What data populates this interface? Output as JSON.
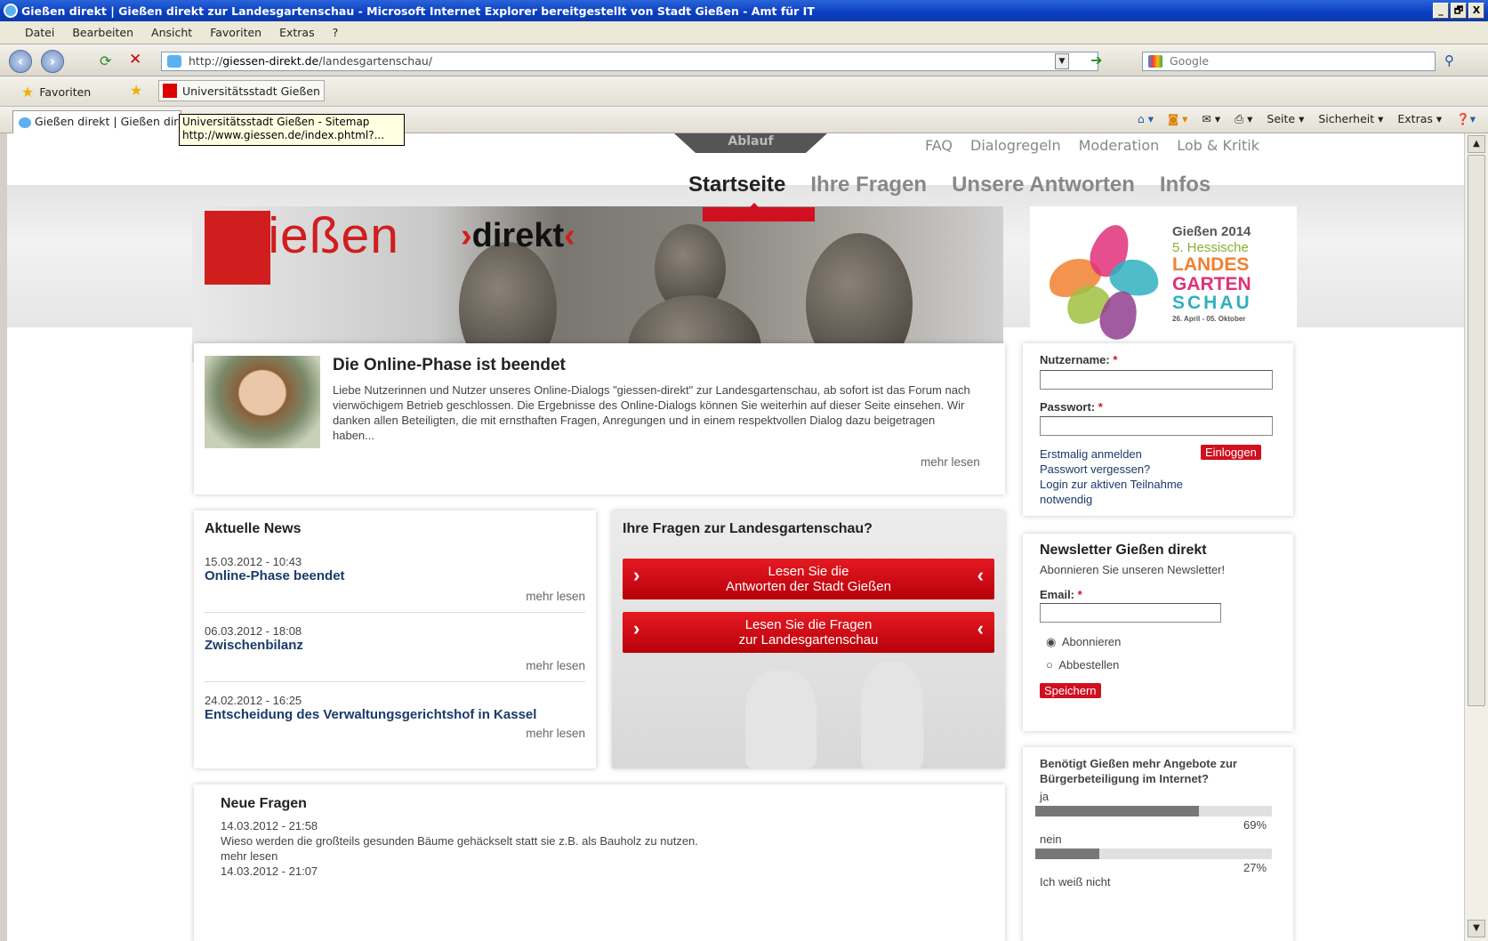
{
  "window": {
    "title": "Gießen direkt | Gießen direkt zur Landesgartenschau - Microsoft Internet Explorer bereitgestellt von Stadt Gießen - Amt für IT",
    "buttons": [
      "_",
      "🗗",
      "X"
    ]
  },
  "menu": [
    "Datei",
    "Bearbeiten",
    "Ansicht",
    "Favoriten",
    "Extras",
    "?"
  ],
  "address": {
    "prefix": "http://",
    "host": "giessen-direkt.de",
    "path": "/landesgartenschau/"
  },
  "search": {
    "placeholder": "Google"
  },
  "favorites": {
    "label": "Favoriten",
    "item": "Universitätsstadt Gießen"
  },
  "tab": {
    "label": "Gießen direkt | Gießen direkt zur Landesgartenschau"
  },
  "tooltip": {
    "line1": "Universitätsstadt Gießen - Sitemap",
    "line2": "http://www.giessen.de/index.phtml?..."
  },
  "commandbar": [
    "Seite ▾",
    "Sicherheit ▾",
    "Extras ▾"
  ],
  "site": {
    "ablauf": "Ablauf",
    "toplinks": [
      "FAQ",
      "Dialogregeln",
      "Moderation",
      "Lob & Kritik"
    ],
    "nav": [
      "Startseite",
      "Ihre Fragen",
      "Unsere Antworten",
      "Infos"
    ],
    "logo": {
      "main": "Gießen",
      "direkt_open": "›",
      "direkt": "direkt",
      "direkt_close": "‹"
    },
    "lgs": {
      "l1": "Gießen 2014",
      "l2": "5. Hessische",
      "l3": "LANDES",
      "l4": "GARTEN",
      "l5": "SCHAU",
      "l6": "26. April - 05. Oktober"
    },
    "online": {
      "title": "Die Online-Phase ist beendet",
      "text": "Liebe Nutzerinnen und Nutzer unseres Online-Dialogs \"giessen-direkt\" zur Landesgartenschau, ab sofort ist das Forum nach vierwöchigem Betrieb geschlossen. Die Ergebnisse des Online-Dialogs können Sie weiterhin auf dieser Seite einsehen. Wir danken allen Beteiligten, die mit ernsthaften Fragen, Anregungen und in einem respektvollen Dialog dazu beigetragen haben...",
      "more": "mehr lesen"
    },
    "news": {
      "title": "Aktuelle News",
      "items": [
        {
          "date": "15.03.2012 - 10:43",
          "title": "Online-Phase beendet",
          "more": "mehr lesen"
        },
        {
          "date": "06.03.2012 - 18:08",
          "title": "Zwischenbilanz",
          "more": "mehr lesen"
        },
        {
          "date": "24.02.2012 - 16:25",
          "title": "Entscheidung des Verwaltungsgerichtshof in Kassel",
          "more": "mehr lesen"
        }
      ]
    },
    "fragen": {
      "title": "Ihre Fragen zur Landesgartenschau?",
      "btn1_l1": "Lesen Sie die",
      "btn1_l2": "Antworten der Stadt Gießen",
      "btn2_l1": "Lesen Sie die Fragen",
      "btn2_l2": "zur Landesgartenschau"
    },
    "neue": {
      "title": "Neue Fragen",
      "d1": "14.03.2012 - 21:58",
      "q1": "Wieso werden die großteils gesunden Bäume gehäckselt statt sie z.B. als Bauholz zu nutzen.",
      "more": "mehr lesen",
      "d2": "14.03.2012 - 21:07"
    },
    "login": {
      "user": "Nutzername:",
      "pass": "Passwort:",
      "req": "*",
      "register": "Erstmalig anmelden",
      "login": "Einloggen",
      "forgot": "Passwort vergessen?",
      "hint1": "Login zur aktiven Teilnahme",
      "hint2": "notwendig"
    },
    "newsletter": {
      "title": "Newsletter Gießen direkt",
      "sub": "Abonnieren Sie unseren Newsletter!",
      "email": "Email:",
      "opt1": "Abonnieren",
      "opt2": "Abbestellen",
      "save": "Speichern"
    },
    "poll": {
      "question": "Benötigt Gießen mehr Angebote zur Bürgerbeteiligung im Internet?",
      "options": [
        {
          "label": "ja",
          "pct": "69%",
          "value": 69
        },
        {
          "label": "nein",
          "pct": "27%",
          "value": 27
        },
        {
          "label": "Ich weiß nicht"
        }
      ]
    }
  }
}
